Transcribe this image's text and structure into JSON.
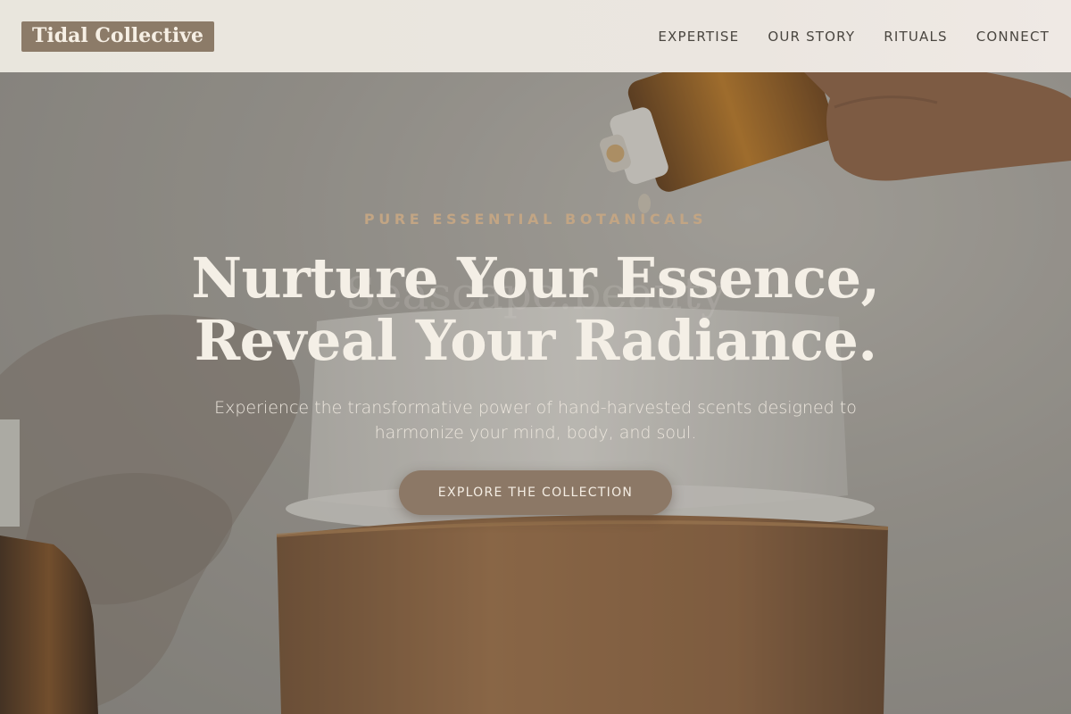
{
  "header": {
    "logo": "Tidal Collective",
    "nav": [
      {
        "label": "EXPERTISE"
      },
      {
        "label": "OUR STORY"
      },
      {
        "label": "RITUALS"
      },
      {
        "label": "CONNECT"
      }
    ]
  },
  "hero": {
    "eyebrow": "PURE ESSENTIAL BOTANICALS",
    "headline_line1": "Nurture Your Essence,",
    "headline_line2": "Reveal Your Radiance.",
    "subtext": "Experience the transformative power of hand-harvested scents designed to harmonize your mind, body, and soul.",
    "cta_label": "EXPLORE THE COLLECTION",
    "background_watermark": "Seascape.beauty"
  },
  "colors": {
    "logo_bg": "#8c7b68",
    "eyebrow": "#c2a584",
    "headline": "#f4efe6",
    "cta_bg": "#8c7866",
    "header_bg": "#eae6de"
  }
}
